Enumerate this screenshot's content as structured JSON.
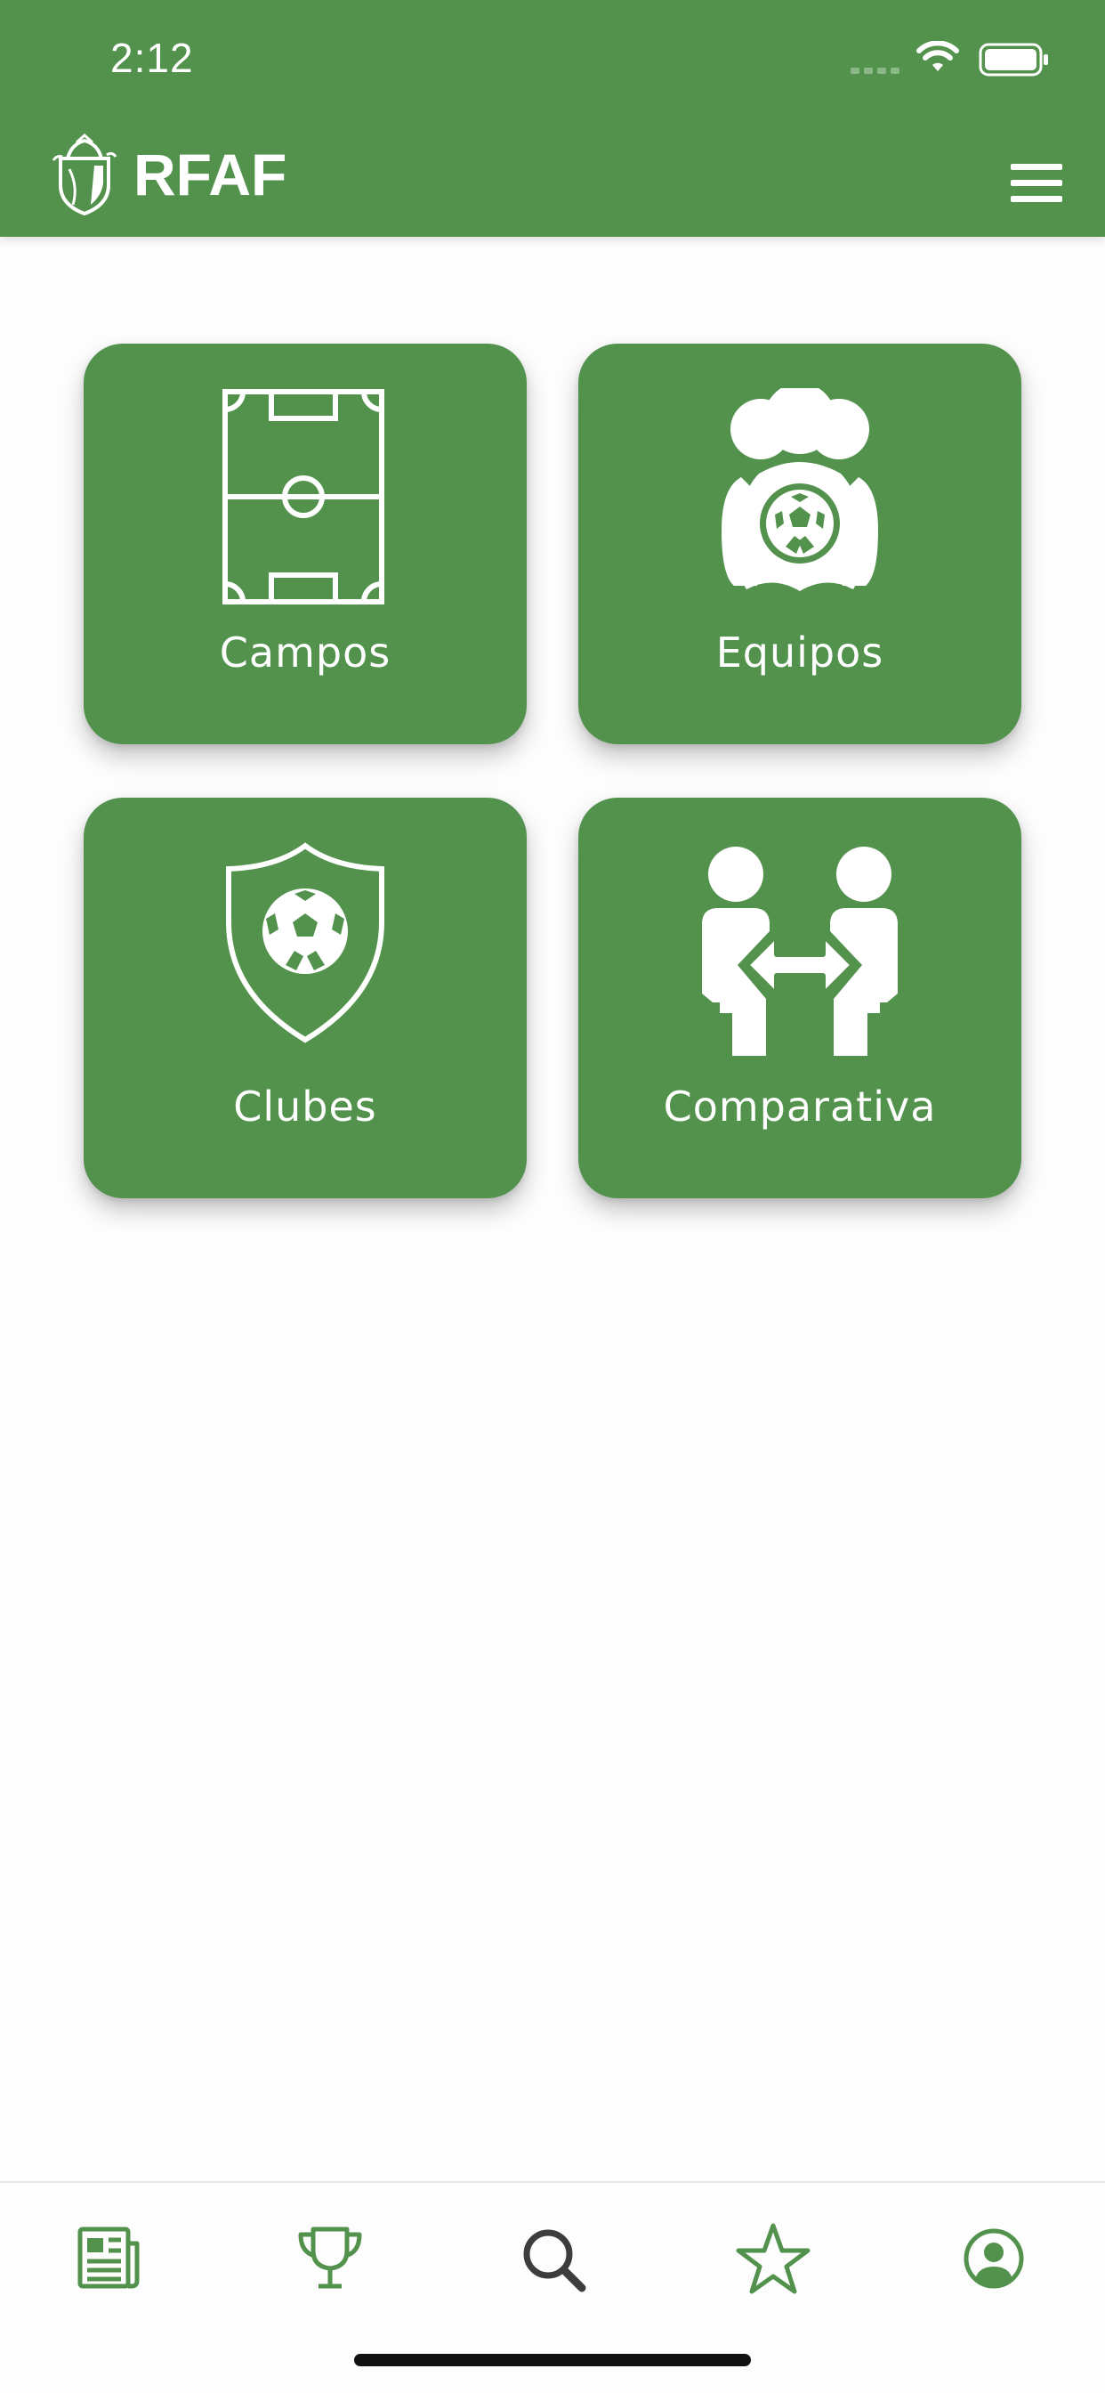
{
  "status_bar": {
    "time": "2:12"
  },
  "header": {
    "logo_text": "RFAF",
    "background_color": "#52924d"
  },
  "tiles": [
    {
      "label": "Campos",
      "icon": "football-field-icon"
    },
    {
      "label": "Equipos",
      "icon": "team-icon"
    },
    {
      "label": "Clubes",
      "icon": "club-shield-icon"
    },
    {
      "label": "Comparativa",
      "icon": "compare-icon"
    }
  ],
  "tabbar": {
    "items": [
      {
        "icon": "news-icon"
      },
      {
        "icon": "trophy-icon"
      },
      {
        "icon": "search-icon",
        "active": true
      },
      {
        "icon": "star-icon"
      },
      {
        "icon": "profile-icon"
      }
    ],
    "accent_color": "#52924d",
    "active_color": "#3d3d3d"
  }
}
